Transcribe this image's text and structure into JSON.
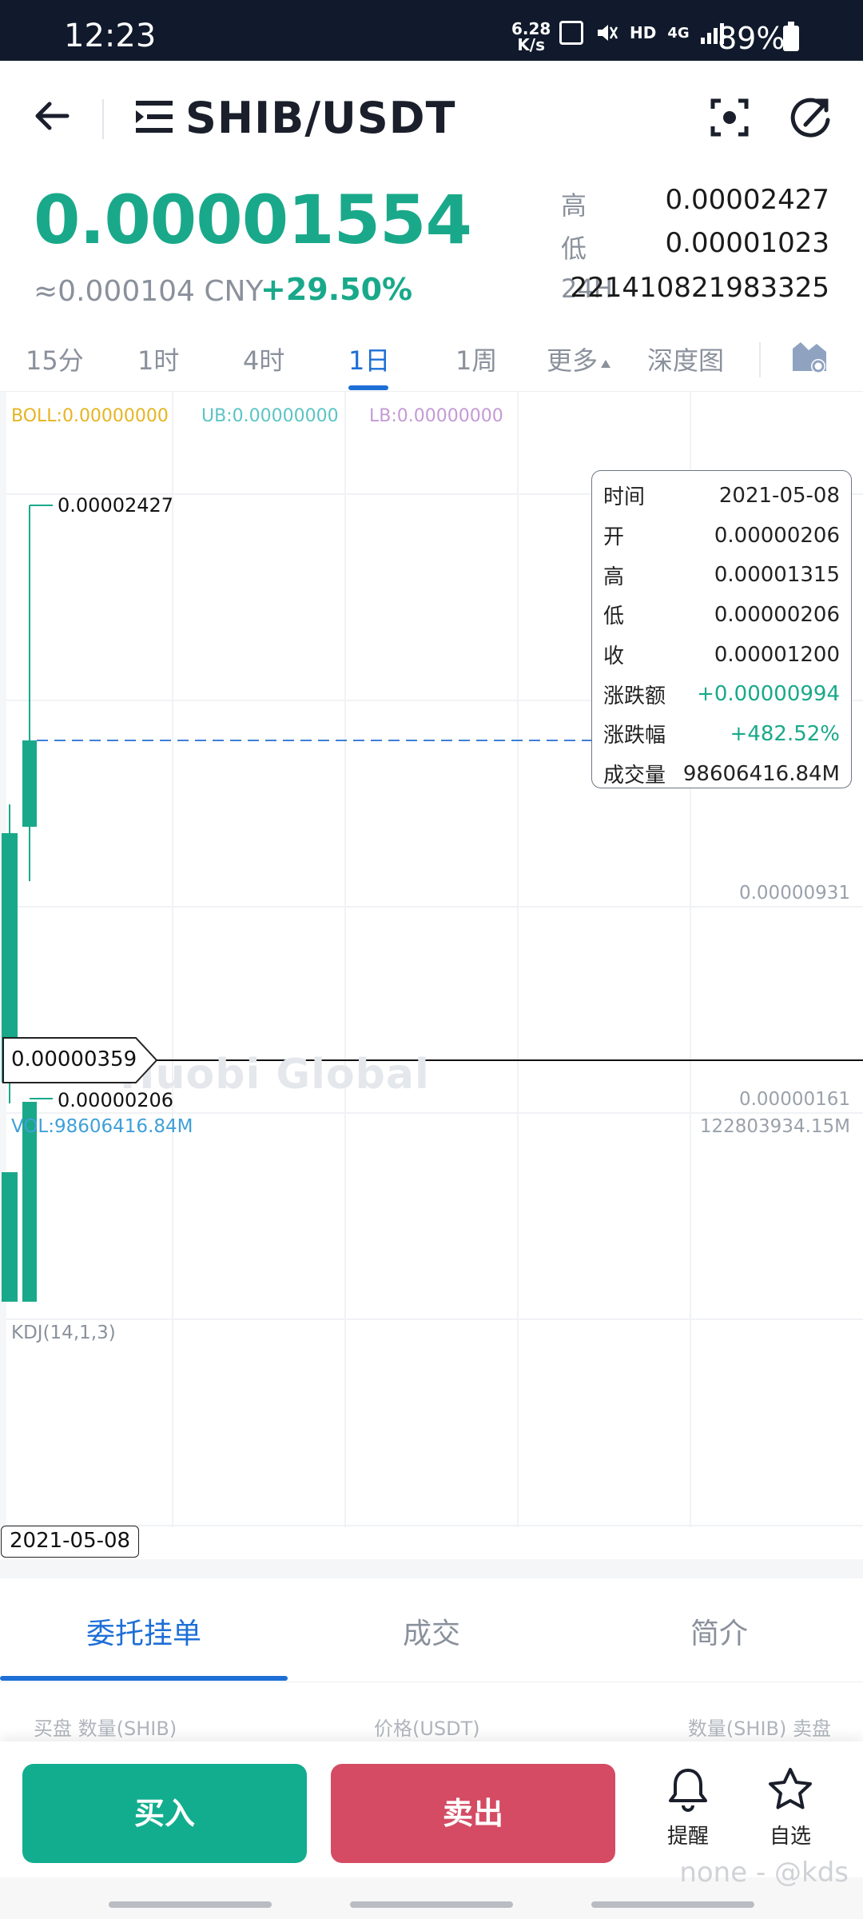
{
  "status_bar": {
    "time": "12:23",
    "net_speed_top": "6.28",
    "net_speed_bottom": "K/s",
    "hd": "HD",
    "network": "4G",
    "battery": "89%"
  },
  "header": {
    "pair": "SHIB/USDT"
  },
  "ticker": {
    "price": "0.00001554",
    "cny": "≈0.000104 CNY",
    "change": "+29.50%",
    "stats": [
      {
        "label": "高",
        "value": "0.00002427"
      },
      {
        "label": "低",
        "value": "0.00001023"
      },
      {
        "label": "24H",
        "value": "221410821983325"
      }
    ]
  },
  "intervals": {
    "items": [
      "15分",
      "1时",
      "4时",
      "1日",
      "1周",
      "更多",
      "深度图"
    ],
    "active": "1日"
  },
  "chart": {
    "boll": "BOLL:0.00000000",
    "ub": "UB:0.00000000",
    "lb": "LB:0.00000000",
    "max_label": "0.00002427",
    "min_label": "0.00000206",
    "axis_mid": "0.00000931",
    "axis_low": "0.00000161",
    "cursor_price": "0.00000359",
    "vol_label": "VOL:98606416.84M",
    "vol_axis": "122803934.15M",
    "kdj": "KDJ(14,1,3)",
    "watermark": "Huobi Global",
    "cursor_date": "2021-05-08",
    "colors": {
      "up": "#19a98a",
      "boll": "#e6b422",
      "ub": "#5bc4c4",
      "lb": "#c49ad6",
      "vol": "#3fa0d8"
    }
  },
  "tooltip": [
    {
      "label": "时间",
      "value": "2021-05-08"
    },
    {
      "label": "开",
      "value": "0.00000206"
    },
    {
      "label": "高",
      "value": "0.00001315"
    },
    {
      "label": "低",
      "value": "0.00000206"
    },
    {
      "label": "收",
      "value": "0.00001200"
    },
    {
      "label": "涨跌额",
      "value": "+0.00000994"
    },
    {
      "label": "涨跌幅",
      "value": "+482.52%"
    },
    {
      "label": "成交量",
      "value": "98606416.84M"
    }
  ],
  "info_tabs": {
    "items": [
      "委托挂单",
      "成交",
      "简介"
    ],
    "active": "委托挂单"
  },
  "orderbook_header": [
    "买盘  数量(SHIB)",
    "价格(USDT)",
    "数量(SHIB)  卖盘"
  ],
  "actions": {
    "buy": "买入",
    "sell": "卖出",
    "alert": "提醒",
    "watch": "自选"
  },
  "signature": "none - @kds"
}
